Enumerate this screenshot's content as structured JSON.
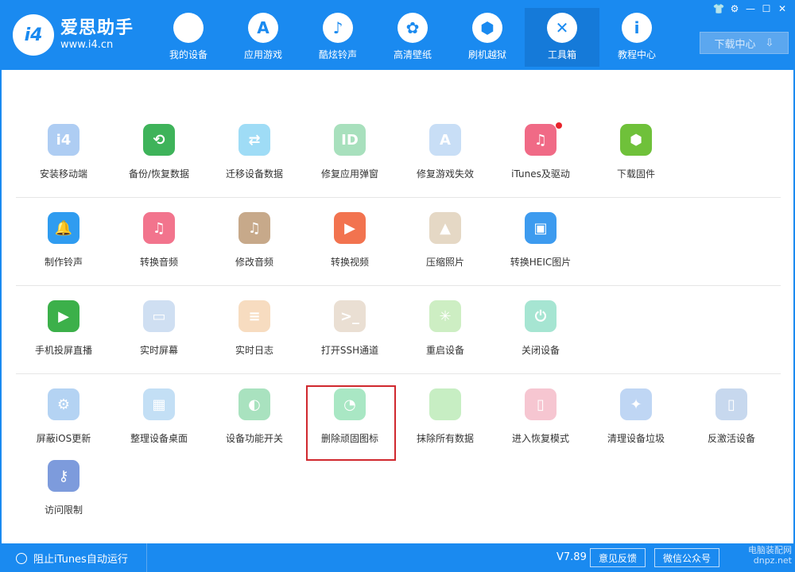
{
  "app": {
    "title": "爱思助手",
    "url": "www.i4.cn",
    "logo_text": "i4"
  },
  "nav": [
    {
      "label": "我的设备",
      "icon": "apple-icon",
      "glyph": ""
    },
    {
      "label": "应用游戏",
      "icon": "app-store-icon",
      "glyph": "A"
    },
    {
      "label": "酷炫铃声",
      "icon": "bell-icon",
      "glyph": "♪"
    },
    {
      "label": "高清壁纸",
      "icon": "flower-icon",
      "glyph": "✿"
    },
    {
      "label": "刷机越狱",
      "icon": "box-icon",
      "glyph": "⬢"
    },
    {
      "label": "工具箱",
      "icon": "tools-icon",
      "glyph": "✕"
    },
    {
      "label": "教程中心",
      "icon": "info-icon",
      "glyph": "i"
    }
  ],
  "nav_active_index": 5,
  "download": {
    "label": "下载中心",
    "glyph": "⇩"
  },
  "window_controls": [
    "👕",
    "⚙",
    "—",
    "☐",
    "✕"
  ],
  "tool_rows": [
    [
      {
        "label": "安装移动端",
        "icon": "i4-mobile-icon",
        "color": "#aecdf3",
        "glyph": "i4"
      },
      {
        "label": "备份/恢复数据",
        "icon": "backup-clock-icon",
        "color": "#3eb35a",
        "glyph": "⟲"
      },
      {
        "label": "迁移设备数据",
        "icon": "migrate-devices-icon",
        "color": "#9fdcf6",
        "glyph": "⇄"
      },
      {
        "label": "修复应用弹窗",
        "icon": "apple-id-icon",
        "color": "#a8e0bd",
        "glyph": "ID"
      },
      {
        "label": "修复游戏失效",
        "icon": "app-store-icon",
        "color": "#c8def6",
        "glyph": "A"
      },
      {
        "label": "iTunes及驱动",
        "icon": "itunes-icon",
        "color": "#f06a86",
        "glyph": "♫",
        "badge": true
      },
      {
        "label": "下载固件",
        "icon": "cube-icon",
        "color": "#6fc13a",
        "glyph": "⬢"
      }
    ],
    [
      {
        "label": "制作铃声",
        "icon": "bell-plus-icon",
        "color": "#2f9cf0",
        "glyph": "🔔"
      },
      {
        "label": "转换音频",
        "icon": "music-note-icon",
        "color": "#f2748d",
        "glyph": "♫"
      },
      {
        "label": "修改音频",
        "icon": "music-edit-icon",
        "color": "#c7a98a",
        "glyph": "♫"
      },
      {
        "label": "转换视频",
        "icon": "play-video-icon",
        "color": "#f2734f",
        "glyph": "▶"
      },
      {
        "label": "压缩照片",
        "icon": "photo-icon",
        "color": "#e5d8c5",
        "glyph": "▲"
      },
      {
        "label": "转换HEIC图片",
        "icon": "heic-photo-icon",
        "color": "#3d9bef",
        "glyph": "▣"
      }
    ],
    [
      {
        "label": "手机投屏直播",
        "icon": "screen-cast-icon",
        "color": "#3cb04a",
        "glyph": "▶"
      },
      {
        "label": "实时屏幕",
        "icon": "monitor-icon",
        "color": "#cfdff2",
        "glyph": "▭"
      },
      {
        "label": "实时日志",
        "icon": "log-document-icon",
        "color": "#f7dcc0",
        "glyph": "≡"
      },
      {
        "label": "打开SSH通道",
        "icon": "terminal-icon",
        "color": "#eadfd3",
        "glyph": ">_"
      },
      {
        "label": "重启设备",
        "icon": "restart-icon",
        "color": "#cdeec3",
        "glyph": "✳"
      },
      {
        "label": "关闭设备",
        "icon": "power-icon",
        "color": "#a6e5d2",
        "glyph": "⏻"
      }
    ],
    [
      {
        "label": "屏蔽iOS更新",
        "icon": "gear-block-icon",
        "color": "#b4d3f3",
        "glyph": "⚙"
      },
      {
        "label": "整理设备桌面",
        "icon": "grid-icon",
        "color": "#c3dff5",
        "glyph": "▦"
      },
      {
        "label": "设备功能开关",
        "icon": "toggle-icon",
        "color": "#a9e2bf",
        "glyph": "◐"
      },
      {
        "label": "删除顽固图标",
        "icon": "pie-clock-icon",
        "color": "#a9e7c4",
        "glyph": "◔"
      },
      {
        "label": "抹除所有数据",
        "icon": "apple-icon",
        "color": "#c7eec3",
        "glyph": ""
      },
      {
        "label": "进入恢复模式",
        "icon": "phone-recovery-icon",
        "color": "#f6c6d1",
        "glyph": "▯"
      },
      {
        "label": "清理设备垃圾",
        "icon": "broom-icon",
        "color": "#bfd6f4",
        "glyph": "✦"
      },
      {
        "label": "反激活设备",
        "icon": "tablet-icon",
        "color": "#c7d8ee",
        "glyph": "▯"
      }
    ],
    [
      {
        "label": "访问限制",
        "icon": "key-lock-icon",
        "color": "#7d9bdc",
        "glyph": "⚷"
      }
    ]
  ],
  "footer": {
    "itunes_toggle_label": "阻止iTunes自动运行",
    "version": "V7.89",
    "feedback_label": "意见反馈",
    "wechat_label": "微信公众号",
    "watermark_line1": "电脑装配网",
    "watermark_line2": "dnpz.net"
  }
}
